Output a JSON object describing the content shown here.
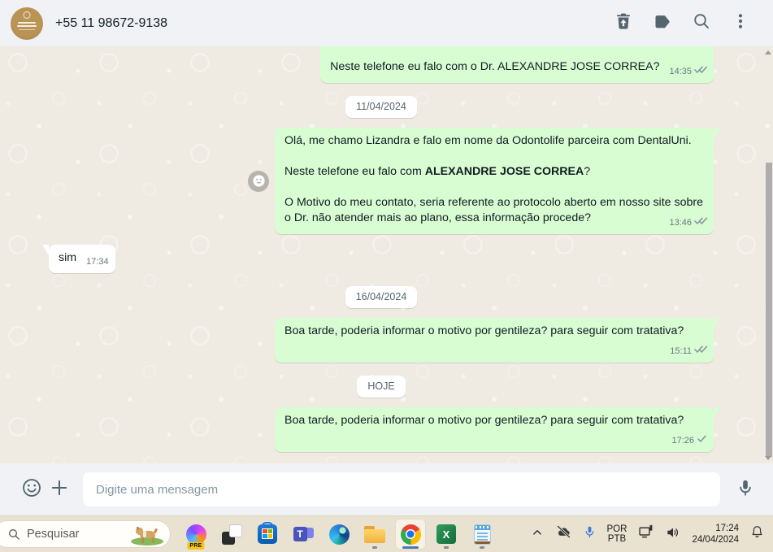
{
  "header": {
    "phone": "+55 11 98672-9138",
    "icons": [
      "trash-restore-icon",
      "label-icon",
      "search-icon",
      "menu-icon"
    ]
  },
  "chat": {
    "items": [
      {
        "type": "message",
        "direction": "out",
        "text": "Neste telefone eu falo com o Dr. ALEXANDRE JOSE CORREA?",
        "time": "14:35",
        "status": "delivered"
      },
      {
        "type": "date",
        "label": "11/04/2024"
      },
      {
        "type": "message",
        "direction": "out",
        "p1": "Olá, me chamo Lizandra e falo em nome da Odontolife parceira com DentalUni.",
        "p2_prefix": "Neste telefone eu falo com ",
        "p2_bold": "ALEXANDRE JOSE CORREA",
        "p2_suffix": "?",
        "p3": "O Motivo do meu contato, seria referente ao protocolo aberto em nosso site sobre o Dr. não atender mais ao plano, essa informação procede?",
        "time": "13:46",
        "status": "delivered"
      },
      {
        "type": "message",
        "direction": "in",
        "text": "sim",
        "time": "17:34"
      },
      {
        "type": "date",
        "label": "16/04/2024"
      },
      {
        "type": "message",
        "direction": "out",
        "text": "Boa tarde, poderia informar o motivo por gentileza? para seguir com tratativa?",
        "time": "15:11",
        "status": "delivered"
      },
      {
        "type": "date",
        "label": "HOJE"
      },
      {
        "type": "message",
        "direction": "out",
        "text": "Boa tarde, poderia informar o motivo por gentileza? para seguir com tratativa?",
        "time": "17:26",
        "status": "sent"
      }
    ]
  },
  "composer": {
    "placeholder": "Digite uma mensagem",
    "icons": [
      "emoji-icon",
      "attach-plus-icon",
      "mic-icon"
    ]
  },
  "taskbar": {
    "search_placeholder": "Pesquisar",
    "copilot_badge": "PRE",
    "apps": [
      "copilot",
      "task-view",
      "microsoft-store",
      "teams",
      "edge",
      "file-explorer",
      "chrome",
      "excel",
      "notepad"
    ],
    "running_apps": [
      "file-explorer",
      "chrome",
      "excel",
      "notepad"
    ],
    "active_app": "chrome",
    "tray": {
      "icons": [
        "chevron-up-icon",
        "onedrive-paused-icon",
        "mic-icon",
        "display-icon",
        "volume-icon",
        "bell-icon"
      ],
      "language_line1": "POR",
      "language_line2": "PTB",
      "time": "17:24",
      "date": "24/04/2024"
    }
  },
  "colors": {
    "header_background": "#f0f2f5",
    "chat_background": "#efeae2",
    "outgoing_bubble": "#d9fdd3",
    "incoming_bubble": "#ffffff",
    "check_gray": "#8696a0",
    "taskbar_background": "#e9e2d1",
    "active_indicator": "#4a78c2"
  }
}
